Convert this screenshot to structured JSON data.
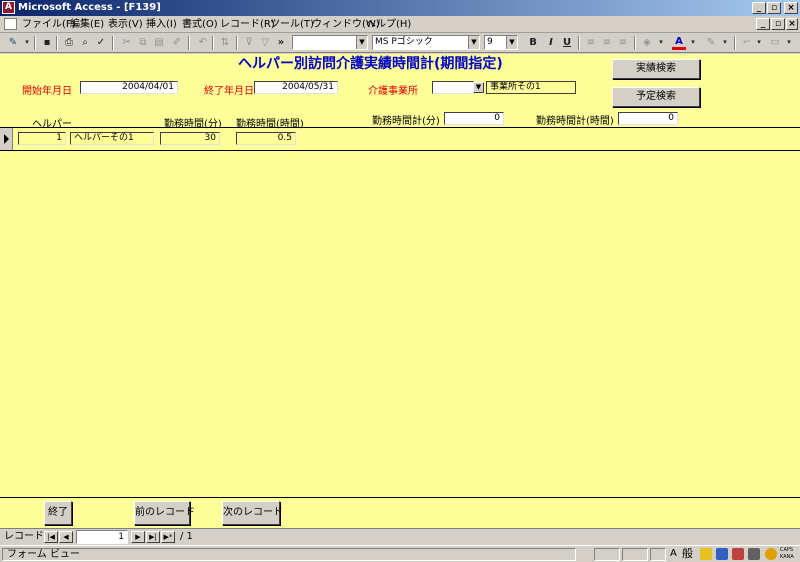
{
  "window": {
    "title": "Microsoft Access - [F139]",
    "app_icon": "access-app-icon",
    "controls": [
      "_",
      "▫",
      "×"
    ],
    "child_controls": [
      "_",
      "▫",
      "×"
    ]
  },
  "menu": [
    "ファイル(F)",
    "編集(E)",
    "表示(V)",
    "挿入(I)",
    "書式(O)",
    "レコード(R)",
    "ツール(T)",
    "ウィンドウ(W)",
    "ヘルプ(H)"
  ],
  "toolbar": {
    "font_name": "MS Pゴシック",
    "font_size": "9",
    "object_combo": "",
    "bold": "B",
    "italic": "I",
    "underline": "U",
    "more": "»"
  },
  "form": {
    "title": "ヘルパー別訪問介護実績時間計(期間指定)",
    "start_label": "開始年月日",
    "start_value": "2004/04/01",
    "end_label": "終了年月日",
    "end_value": "2004/05/31",
    "office_label": "介護事業所",
    "office_code": "",
    "office_name": "事業所その1",
    "search_actual": "実績検索",
    "search_planned": "予定検索",
    "col_helper": "ヘルパー",
    "col_minutes": "勤務時間(分)",
    "col_hours": "勤務時間(時間)",
    "total_minutes_label": "勤務時間計(分)",
    "total_minutes_value": "0",
    "total_hours_label": "勤務時間計(時間)",
    "total_hours_value": "0",
    "rows": [
      {
        "helper_id": "1",
        "helper_name": "ヘルパーその1",
        "minutes": "30",
        "hours": "0.5"
      }
    ],
    "btn_close": "終了",
    "btn_prev": "前のレコード",
    "btn_next": "次のレコード"
  },
  "nav": {
    "label": "レコード:",
    "current": "1",
    "total": "/ 1",
    "first": "|◀",
    "prev": "◀",
    "next": "▶",
    "last": "▶|",
    "new": "▶*"
  },
  "status": {
    "text": "フォーム ビュー",
    "ime_mode": "般",
    "caps": "CAPS",
    "kana": "KANA"
  }
}
